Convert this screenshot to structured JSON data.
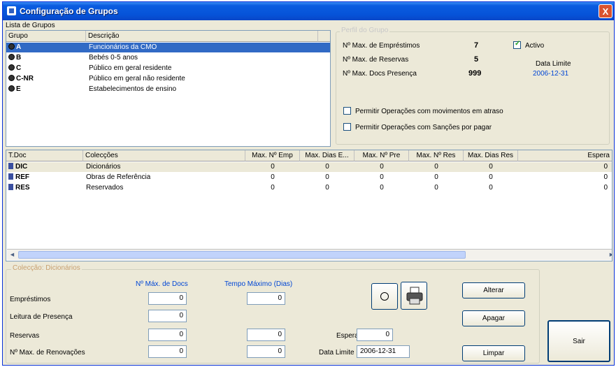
{
  "window": {
    "title": "Configuração de Grupos",
    "close_label": "X"
  },
  "groups": {
    "section_label": "Lista de Grupos",
    "columns": [
      "Grupo",
      "Descrição"
    ],
    "rows": [
      {
        "code": "A",
        "desc": "Funcionários da CMO",
        "selected": true
      },
      {
        "code": "B",
        "desc": "Bebés 0-5 anos",
        "selected": false
      },
      {
        "code": "C",
        "desc": "Público em geral residente",
        "selected": false
      },
      {
        "code": "C-NR",
        "desc": "Público em geral não residente",
        "selected": false
      },
      {
        "code": "E",
        "desc": "Estabelecimentos de ensino",
        "selected": false
      }
    ]
  },
  "profile": {
    "legend": "Perfil do Grupo",
    "max_loans_label": "Nº Max. de Empréstimos",
    "max_loans_value": "7",
    "max_reservations_label": "Nº Max. de Reservas",
    "max_reservations_value": "5",
    "max_presence_label": "Nº Max. Docs Presença",
    "max_presence_value": "999",
    "active_label": "Activo",
    "limit_date_label": "Data Limite",
    "limit_date_value": "2006-12-31",
    "allow_delays_label": "Permitir Operações com movimentos em atraso",
    "allow_sanctions_label": "Permitir Operações com Sanções por pagar"
  },
  "doctypes": {
    "columns": [
      "T.Doc",
      "Colecções",
      "Max. Nº Emp",
      "Max. Dias E...",
      "Max. Nº Pre",
      "Max. Nº Res",
      "Max. Dias Res",
      "Espera"
    ],
    "rows": [
      {
        "code": "DIC",
        "name": "Dicionários",
        "v1": "0",
        "v2": "0",
        "v3": "0",
        "v4": "0",
        "v5": "0",
        "v6": "0",
        "selected": true
      },
      {
        "code": "REF",
        "name": "Obras de Referência",
        "v1": "0",
        "v2": "0",
        "v3": "0",
        "v4": "0",
        "v5": "0",
        "v6": "0",
        "selected": false
      },
      {
        "code": "RES",
        "name": "Reservados",
        "v1": "0",
        "v2": "0",
        "v3": "0",
        "v4": "0",
        "v5": "0",
        "v6": "0",
        "selected": false
      }
    ]
  },
  "collection": {
    "legend": "Colecção: Dicionários",
    "docs_header": "Nº Máx. de Docs",
    "time_header": "Tempo Máximo (Dias)",
    "loans_label": "Empréstimos",
    "loans_docs": "0",
    "loans_days": "0",
    "presence_label": "Leitura de Presença",
    "presence_docs": "0",
    "reservations_label": "Reservas",
    "reservations_docs": "0",
    "reservations_days": "0",
    "renewals_label": "Nº Max. de Renovações",
    "renewals_docs": "0",
    "renewals_days": "0",
    "wait_label": "Espera",
    "wait_value": "0",
    "limit_date_label": "Data Limite",
    "limit_date_value": "2006-12-31"
  },
  "buttons": {
    "change": "Alterar",
    "delete": "Apagar",
    "clear": "Limpar",
    "exit": "Sair"
  }
}
